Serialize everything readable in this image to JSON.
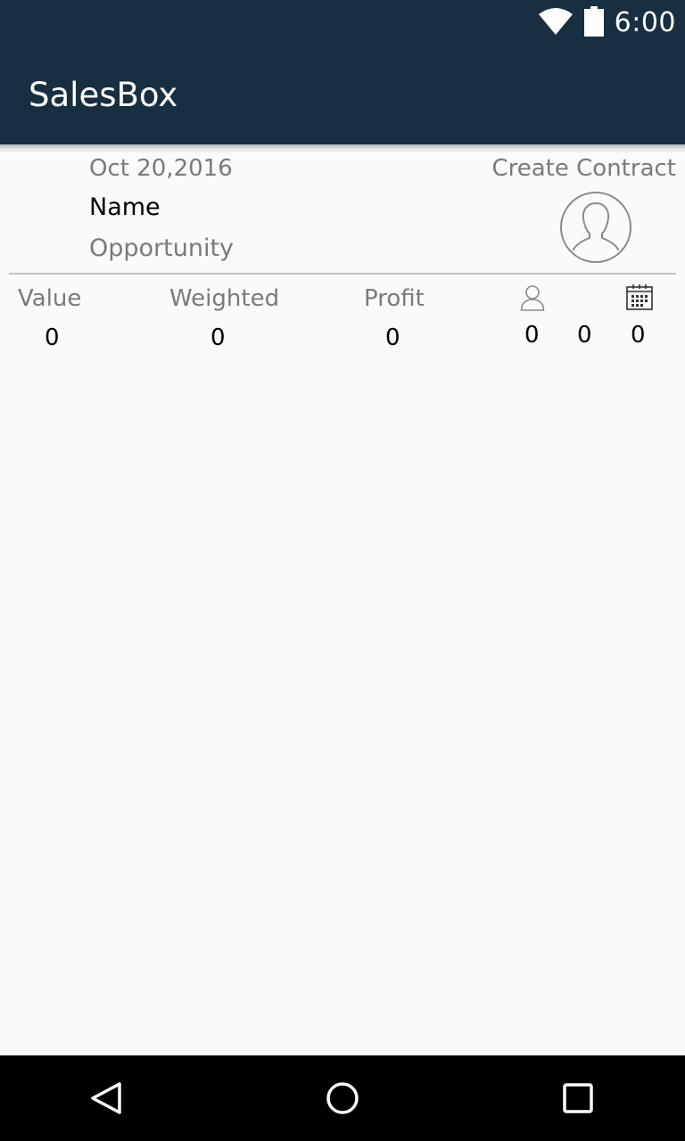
{
  "status_bar": {
    "time": "6:00",
    "icons": [
      "wifi-icon",
      "battery-icon"
    ]
  },
  "app_bar": {
    "title": "SalesBox"
  },
  "header": {
    "date": "Oct 20,2016",
    "name": "Name",
    "opportunity": "Opportunity",
    "create_contract": "Create Contract",
    "avatar_icon": "avatar-placeholder-icon"
  },
  "stats": {
    "value_label": "Value",
    "value": "0",
    "weighted_label": "Weighted",
    "weighted": "0",
    "profit_label": "Profit",
    "profit": "0",
    "contacts_icon": "person-icon",
    "contacts_count": "0",
    "middle_count": "0",
    "calendar_icon": "calendar-icon",
    "calendar_count": "0"
  },
  "nav_bar": {
    "buttons": [
      "back-icon",
      "home-icon",
      "recents-icon"
    ]
  },
  "colors": {
    "app_bar": "#172f40",
    "background": "#fafafa",
    "secondary_text": "#7a7a7a",
    "divider": "#c4c4c4"
  }
}
